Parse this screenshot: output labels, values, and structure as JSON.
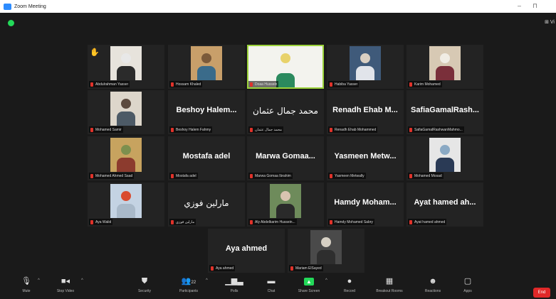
{
  "window": {
    "title": "Zoom Meeting",
    "minimize": "–",
    "maximize": "⊓"
  },
  "top_right": {
    "view_label": "⊞ Vi"
  },
  "participants": [
    {
      "id": "p1",
      "tag": "Abdulrahman Yasser",
      "hand": "✋",
      "photo": [
        "#e7e3dc",
        "#e8e8e8",
        "#2b2b2b"
      ]
    },
    {
      "id": "p2",
      "tag": "Hossam Khaled",
      "photo": [
        "#c89f6a",
        "#7b5a3a",
        "#3a6b8a"
      ]
    },
    {
      "id": "p3",
      "tag": "Doaa Hussein",
      "active": true,
      "photo": [
        "#f3f3ee",
        "#e8d26a",
        "#2b8a5e"
      ]
    },
    {
      "id": "p4",
      "tag": "Habiba Yasser",
      "photo": [
        "#3f5a7a",
        "#d9cfc2",
        "#e1e4ea"
      ]
    },
    {
      "id": "p5",
      "tag": "Karim Mohamed",
      "photo": [
        "#d7c9b4",
        "#f0ece4",
        "#7a2f3a"
      ]
    },
    {
      "id": "p6",
      "tag": "Mohamed Samir",
      "photo": [
        "#ddd6cb",
        "#5c4a3f",
        "#4d5a66"
      ]
    },
    {
      "id": "p7",
      "tag": "Beshoy Halem Fahmy",
      "display": "Beshoy Halem..."
    },
    {
      "id": "p8",
      "tag": "محمد جمال عثمان",
      "display": "محمد جمال عثمان",
      "arabic": true
    },
    {
      "id": "p9",
      "tag": "Renadh Ehab Mohammed",
      "display": "Renadh Ehab M..."
    },
    {
      "id": "p10",
      "tag": "SafiaGamalRashwanMahmo...",
      "display": "SafiaGamalRash..."
    },
    {
      "id": "p11",
      "tag": "Mohamed Ahmed Saad",
      "photo": [
        "#c7a35f",
        "#7d8f4e",
        "#8c3b2e"
      ]
    },
    {
      "id": "p12",
      "tag": "Mostafa adel",
      "display": "Mostafa adel"
    },
    {
      "id": "p13",
      "tag": "Marwa Gomaa Ibrahim",
      "display": "Marwa Gomaa..."
    },
    {
      "id": "p14",
      "tag": "Yasmeen Metwally",
      "display": "Yasmeen Metw..."
    },
    {
      "id": "p15",
      "tag": "Mohamed Mosad",
      "photo": [
        "#e6e6e6",
        "#8aa9c4",
        "#2a3a55"
      ]
    },
    {
      "id": "p16",
      "tag": "Aya Walid",
      "photo": [
        "#c4d3e3",
        "#d94b2f",
        "#a9b9c9"
      ]
    },
    {
      "id": "p17",
      "tag": "مارلين فوزي",
      "display": "مارلين فوزي",
      "arabic": true
    },
    {
      "id": "p18",
      "tag": "Aly Abdelkarim Hussein...",
      "photo": [
        "#6e8b5b",
        "#d9c4b0",
        "#2a2a2a"
      ]
    },
    {
      "id": "p19",
      "tag": "Hamdy Mohamed Sabry",
      "display": "Hamdy Moham..."
    },
    {
      "id": "p20",
      "tag": "Ayat hamed ahmed",
      "display": "Ayat hamed ah..."
    },
    {
      "id": "p21",
      "tag": "Aya ahmed",
      "display": "Aya ahmed"
    },
    {
      "id": "p22",
      "tag": "Mariam ElSayed",
      "photo": [
        "#4a4a4a",
        "#d6d0c4",
        "#2e2e2e"
      ]
    }
  ],
  "toolbar": {
    "mute": "Mute",
    "stop_video": "Stop Video",
    "security": "Security",
    "participants": "Participants",
    "participants_count": "22",
    "polls": "Polls",
    "chat": "Chat",
    "share_screen": "Share Screen",
    "record": "Record",
    "breakout_rooms": "Breakout Rooms",
    "reactions": "Reactions",
    "apps": "Apps",
    "end": "End"
  },
  "colors": {
    "active_border": "#9bd23a",
    "mic_muted": "#e0322a",
    "share": "#23d959",
    "end": "#e02828"
  }
}
